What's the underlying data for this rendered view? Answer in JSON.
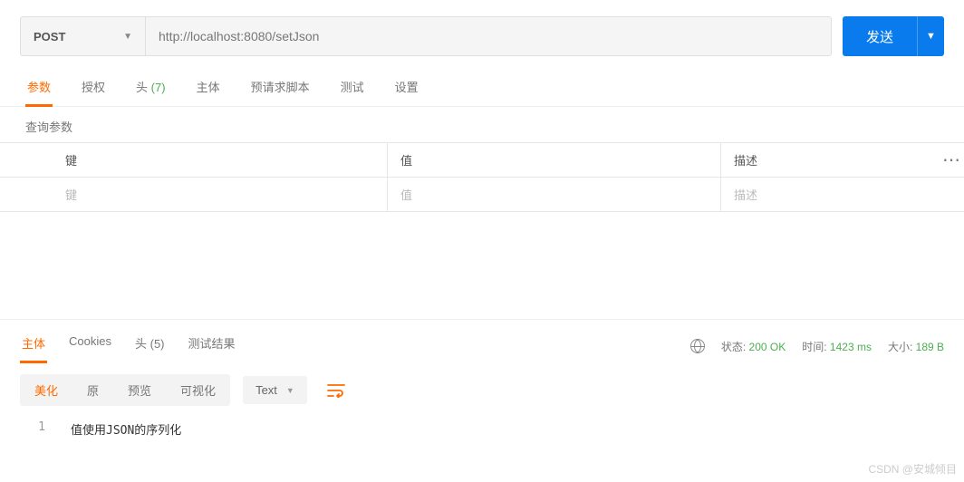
{
  "request": {
    "method": "POST",
    "url": "http://localhost:8080/setJson",
    "send_label": "发送"
  },
  "tabs": {
    "params": "参数",
    "auth": "授权",
    "headers": "头",
    "headers_count": "(7)",
    "body": "主体",
    "prerequest": "预请求脚本",
    "tests": "测试",
    "settings": "设置"
  },
  "query_section_label": "查询参数",
  "param_headers": {
    "key": "键",
    "value": "值",
    "desc": "描述"
  },
  "param_placeholders": {
    "key": "键",
    "value": "值",
    "desc": "描述"
  },
  "response_tabs": {
    "body": "主体",
    "cookies": "Cookies",
    "headers": "头",
    "headers_count": "(5)",
    "test_results": "测试结果"
  },
  "status": {
    "state_label": "状态:",
    "state_value": "200 OK",
    "time_label": "时间:",
    "time_value": "1423 ms",
    "size_label": "大小:",
    "size_value": "189 B"
  },
  "toolbar": {
    "pretty": "美化",
    "raw": "原",
    "preview": "预览",
    "visualize": "可视化",
    "format": "Text"
  },
  "body": {
    "line_no": "1",
    "content": "值使用JSON的序列化"
  },
  "watermark": "CSDN @安城倾目"
}
